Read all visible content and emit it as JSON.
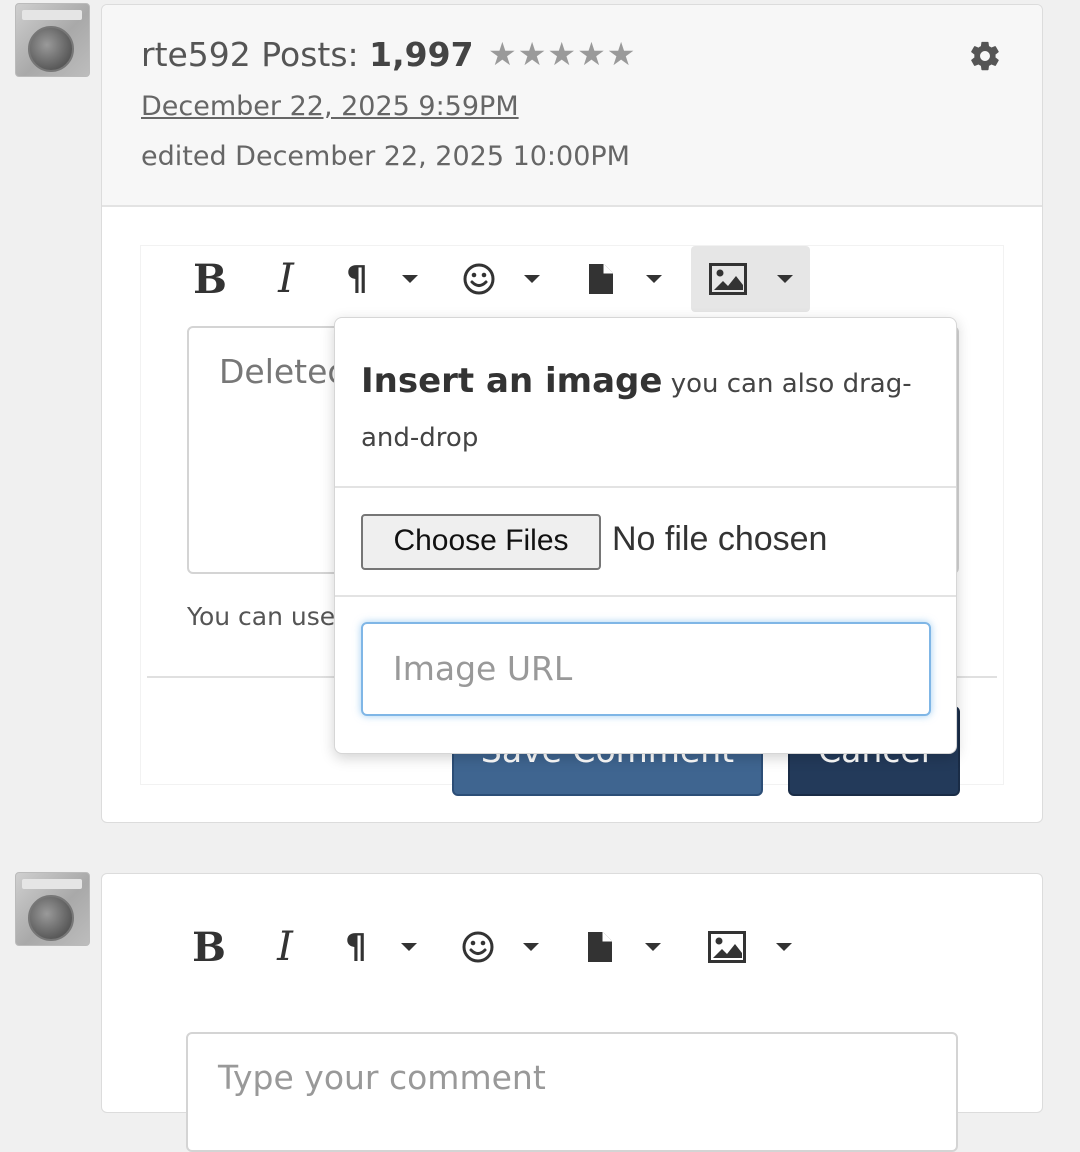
{
  "comment": {
    "author": "rte592",
    "posts_label": "Posts:",
    "posts_count": "1,997",
    "stars": "★★★★★",
    "date": "December 22, 2025 9:59PM",
    "edited": "edited December 22, 2025 10:00PM",
    "edit_text": "Deletec",
    "hint_text": "You can use",
    "save_label": "Save Comment",
    "cancel_label": "Cancel"
  },
  "toolbar": {
    "bold": "B",
    "italic": "I",
    "paragraph": "¶",
    "emoji": "☺"
  },
  "image_popover": {
    "title": "Insert an image",
    "subtitle": "you can also drag-and-drop",
    "choose_files_label": "Choose Files",
    "file_status": "No file chosen",
    "url_placeholder": "Image URL"
  },
  "new_comment": {
    "placeholder": "Type your comment"
  }
}
